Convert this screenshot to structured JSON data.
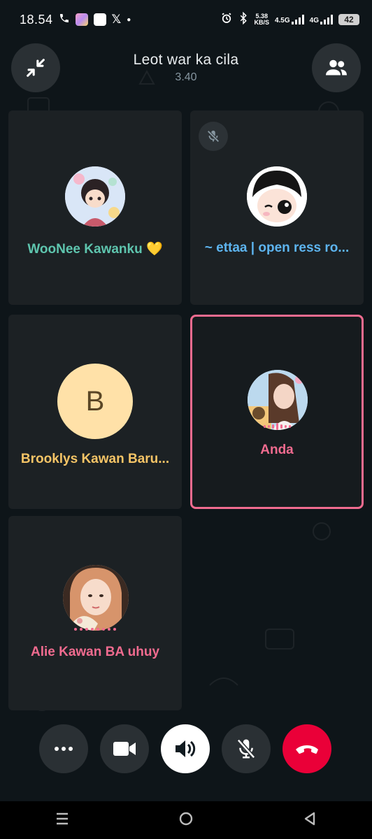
{
  "status_bar": {
    "time": "18.54",
    "net_speed_top": "5.38",
    "net_speed_bottom": "KB/S",
    "net1": "4.5G",
    "net2": "4G",
    "battery": "42"
  },
  "call": {
    "title": "Leot war ka cila",
    "timer": "3.40"
  },
  "participants": [
    {
      "name": "WooNee Kawanku 💛",
      "color": "#5ec5ae"
    },
    {
      "name": "~ ettaa | open ress ro...",
      "color": "#5db4ef"
    },
    {
      "name": "Brooklys Kawan Baru...",
      "color": "#f5c466",
      "initial": "B"
    },
    {
      "name": "Anda",
      "color": "#f06b8f"
    },
    {
      "name": "Alie Kawan BA uhuy",
      "color": "#f06b8f"
    }
  ],
  "colors": {
    "accent_pink": "#f06b8f",
    "end_call_red": "#ea0038",
    "tile_bg": "#1c2124",
    "avatar_b_bg": "#ffe1a8"
  },
  "icons": {
    "minimize": "minimize-icon",
    "participants": "participants-icon",
    "more": "more-icon",
    "video": "video-icon",
    "speaker": "speaker-icon",
    "mic_off": "mic-off-icon",
    "end_call": "end-call-icon"
  }
}
